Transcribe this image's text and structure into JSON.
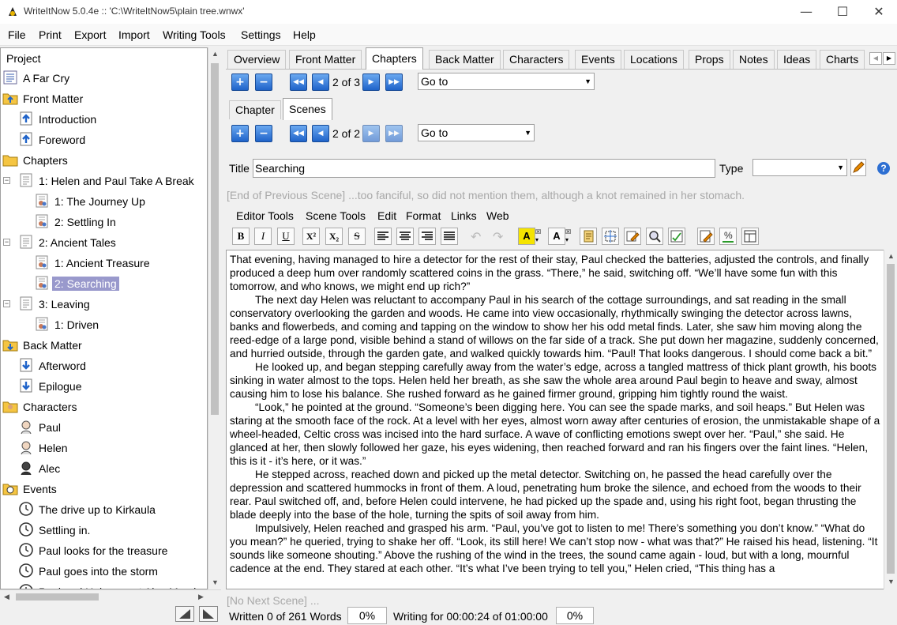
{
  "window": {
    "title": "WriteItNow 5.0.4e :: 'C:\\WriteItNow5\\plain tree.wnwx'"
  },
  "menu": [
    "File",
    "Print",
    "Export",
    "Import",
    "Writing Tools",
    "Settings",
    "Help"
  ],
  "tree": {
    "header": "Project",
    "nodes": [
      {
        "label": "A Far Cry",
        "level": 0,
        "icon": "project-icon"
      },
      {
        "label": "Front Matter",
        "level": 0,
        "icon": "folder-up-icon"
      },
      {
        "label": "Introduction",
        "level": 1,
        "icon": "up-doc-icon"
      },
      {
        "label": "Foreword",
        "level": 1,
        "icon": "up-doc-icon"
      },
      {
        "label": "Chapters",
        "level": 0,
        "icon": "folder-icon"
      },
      {
        "label": "1: Helen and Paul Take A Break",
        "level": 1,
        "icon": "chapter-icon",
        "expander": "−"
      },
      {
        "label": "1: The Journey Up",
        "level": 2,
        "icon": "scene-icon"
      },
      {
        "label": "2: Settling In",
        "level": 2,
        "icon": "scene-icon"
      },
      {
        "label": "2: Ancient Tales",
        "level": 1,
        "icon": "chapter-icon",
        "expander": "−"
      },
      {
        "label": "1: Ancient Treasure",
        "level": 2,
        "icon": "scene-icon"
      },
      {
        "label": "2: Searching",
        "level": 2,
        "icon": "scene-icon",
        "selected": true
      },
      {
        "label": "3: Leaving",
        "level": 1,
        "icon": "chapter-icon",
        "expander": "−"
      },
      {
        "label": "1: Driven",
        "level": 2,
        "icon": "scene-icon"
      },
      {
        "label": "Back Matter",
        "level": 0,
        "icon": "folder-down-icon"
      },
      {
        "label": "Afterword",
        "level": 1,
        "icon": "down-doc-icon"
      },
      {
        "label": "Epilogue",
        "level": 1,
        "icon": "down-doc-icon"
      },
      {
        "label": "Characters",
        "level": 0,
        "icon": "characters-folder-icon"
      },
      {
        "label": "Paul",
        "level": 1,
        "icon": "person-icon"
      },
      {
        "label": "Helen",
        "level": 1,
        "icon": "person-icon"
      },
      {
        "label": "Alec",
        "level": 1,
        "icon": "person-dark-icon"
      },
      {
        "label": "Events",
        "level": 0,
        "icon": "events-folder-icon"
      },
      {
        "label": "The drive up to Kirkaula",
        "level": 1,
        "icon": "clock-icon"
      },
      {
        "label": "Settling in.",
        "level": 1,
        "icon": "clock-icon"
      },
      {
        "label": "Paul looks for the treasure",
        "level": 1,
        "icon": "clock-icon"
      },
      {
        "label": "Paul goes into the storm",
        "level": 1,
        "icon": "clock-icon"
      },
      {
        "label": "Paul and Helen meet Alec Macdon",
        "level": 1,
        "icon": "clock-icon"
      }
    ]
  },
  "tabs": [
    "Overview",
    "Front Matter",
    "Chapters",
    "Back Matter",
    "Characters",
    "Events",
    "Locations",
    "Props",
    "Notes",
    "Ideas",
    "Charts"
  ],
  "active_tab": "Chapters",
  "chapter_nav": {
    "pos": "2 of 3",
    "goto": "Go to"
  },
  "subtabs": [
    "Chapter",
    "Scenes"
  ],
  "active_subtab": "Scenes",
  "scene_nav": {
    "pos": "2 of 2",
    "goto": "Go to"
  },
  "title_label": "Title",
  "title_value": "Searching",
  "type_label": "Type",
  "prev_scene": "[End of Previous Scene] ...too fanciful, so did not mention them, although a knot remained in her stomach.",
  "editor_menu": [
    "Editor Tools",
    "Scene Tools",
    "Edit",
    "Format",
    "Links",
    "Web"
  ],
  "format": {
    "bold": "B",
    "italic": "I",
    "underline": "U",
    "superscript": "X²",
    "subscript": "X₂",
    "strike": "S"
  },
  "paragraphs": [
    "That evening, having managed to hire a detector for the rest of their stay, Paul checked the batteries, adjusted the controls, and finally produced a deep hum over randomly scattered coins in the grass. “There,” he said, switching off. “We’ll have some fun with this tomorrow, and who knows, we might end up rich?”",
    "The next day Helen was reluctant to accompany Paul in his search of the cottage surroundings, and sat reading in the small conservatory overlooking the garden and woods. He came into view occasionally, rhythmically swinging the detector across lawns, banks and flowerbeds, and coming and tapping on the window to show her his odd metal finds. Later, she saw him moving along the reed-edge of a large pond, visible behind a stand of willows on the far side of a track. She put down her magazine, suddenly concerned, and hurried outside, through the garden gate, and walked quickly towards him. “Paul! That looks dangerous. I should come back a bit.”",
    "He looked up, and began stepping carefully away from the water’s edge, across a tangled mattress of thick plant growth, his boots sinking in water almost to the tops. Helen held her breath, as she saw the whole area around Paul begin to heave and sway, almost causing him to lose his balance. She rushed forward as he gained firmer ground, gripping him tightly round the waist.",
    "“Look,” he pointed at the ground. “Someone’s been digging here. You can see the spade marks, and soil heaps.” But Helen was staring at the smooth face of the rock. At a level with her eyes, almost worn away after centuries of erosion, the unmistakable shape of a wheel-headed, Celtic cross was incised into the hard surface. A wave of conflicting emotions swept over her. “Paul,” she said. He glanced at her, then slowly followed her gaze, his eyes widening, then reached forward and ran his fingers over the faint lines. “Helen, this is it - it’s here, or it was.”",
    "He stepped across, reached down and picked up the metal detector. Switching on, he passed the head carefully over the depression and scattered hummocks in front of them. A loud, penetrating hum broke the silence, and echoed from the woods to their rear. Paul switched off, and, before Helen could intervene, he had picked up the spade and, using his right foot, began thrusting the blade deeply into the base of the hole, turning the spits of soil away from him.",
    "Impulsively, Helen reached and grasped his arm. “Paul, you’ve got to listen to me! There’s something you don’t know.” “What do you mean?” he queried, trying to shake her off. “Look, its still here! We can’t stop now - what was that?” He raised his head, listening. “It sounds like someone shouting.” Above the rushing of the wind in the trees, the sound came again - loud, but with a long, mournful cadence at the end. They stared at each other. “It’s what I’ve been trying to tell you,” Helen cried, “This thing has a"
  ],
  "next_scene": "[No Next Scene] ...",
  "status": {
    "words": "Written 0 of 261 Words",
    "words_pct": "0%",
    "time": "Writing for 00:00:24 of 01:00:00",
    "time_pct": "0%"
  },
  "colors": {
    "selection": "#9999cc",
    "accent_blue": "#1f63c9"
  }
}
